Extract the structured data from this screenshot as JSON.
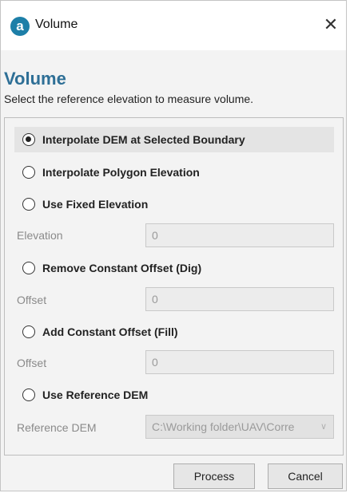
{
  "window": {
    "title": "Volume",
    "app_icon_glyph": "a",
    "close_glyph": "✕"
  },
  "header": {
    "heading": "Volume",
    "subheading": "Select the reference elevation to measure volume."
  },
  "options": [
    {
      "label": "Interpolate DEM at Selected Boundary",
      "selected": true
    },
    {
      "label": "Interpolate Polygon Elevation",
      "selected": false
    },
    {
      "label": "Use Fixed Elevation",
      "selected": false
    },
    {
      "label": "Remove Constant Offset (Dig)",
      "selected": false
    },
    {
      "label": "Add Constant Offset (Fill)",
      "selected": false
    },
    {
      "label": "Use Reference DEM",
      "selected": false
    }
  ],
  "fields": {
    "elevation": {
      "label": "Elevation",
      "value": "0"
    },
    "dig_offset": {
      "label": "Offset",
      "value": "0"
    },
    "fill_offset": {
      "label": "Offset",
      "value": "0"
    },
    "reference_dem": {
      "label": "Reference DEM",
      "value": "C:\\Working folder\\UAV\\Corre"
    }
  },
  "buttons": {
    "process": "Process",
    "cancel": "Cancel"
  },
  "colors": {
    "heading": "#2e6f96",
    "app_icon": "#1d7fa8",
    "selected_row": "#e4e4e4"
  }
}
